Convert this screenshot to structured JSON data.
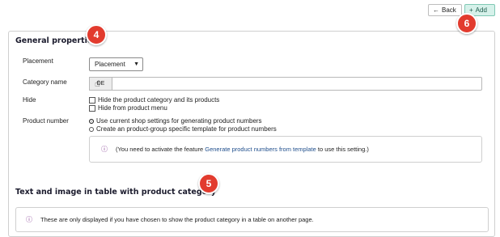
{
  "toolbar": {
    "back_label": "Back",
    "add_label": "Add",
    "back_icon": "arrow-left-icon",
    "add_icon": "plus-icon",
    "add_color": "#d6f1ea"
  },
  "badges": {
    "b4": "4",
    "b5": "5",
    "b6": "6",
    "color": "#e23b2e"
  },
  "general": {
    "title": "General properties",
    "placement": {
      "label": "Placement",
      "value": "Placement"
    },
    "category_name": {
      "label": "Category name",
      "lang": "DE",
      "value": ""
    },
    "hide": {
      "label": "Hide",
      "opt1": "Hide the product category and its products",
      "opt2": "Hide from product menu"
    },
    "product_number": {
      "label": "Product number",
      "opt1": "Use current shop settings for generating product numbers",
      "opt2": "Create an product-group specific template for product numbers",
      "info_prefix": "(You need to activate the feature ",
      "info_link": "Generate product numbers from template",
      "info_suffix": " to use this setting.)"
    }
  },
  "text_image": {
    "title": "Text and image in table with product category",
    "info": "These are only displayed if you have chosen to show the product category in a table on another page."
  }
}
